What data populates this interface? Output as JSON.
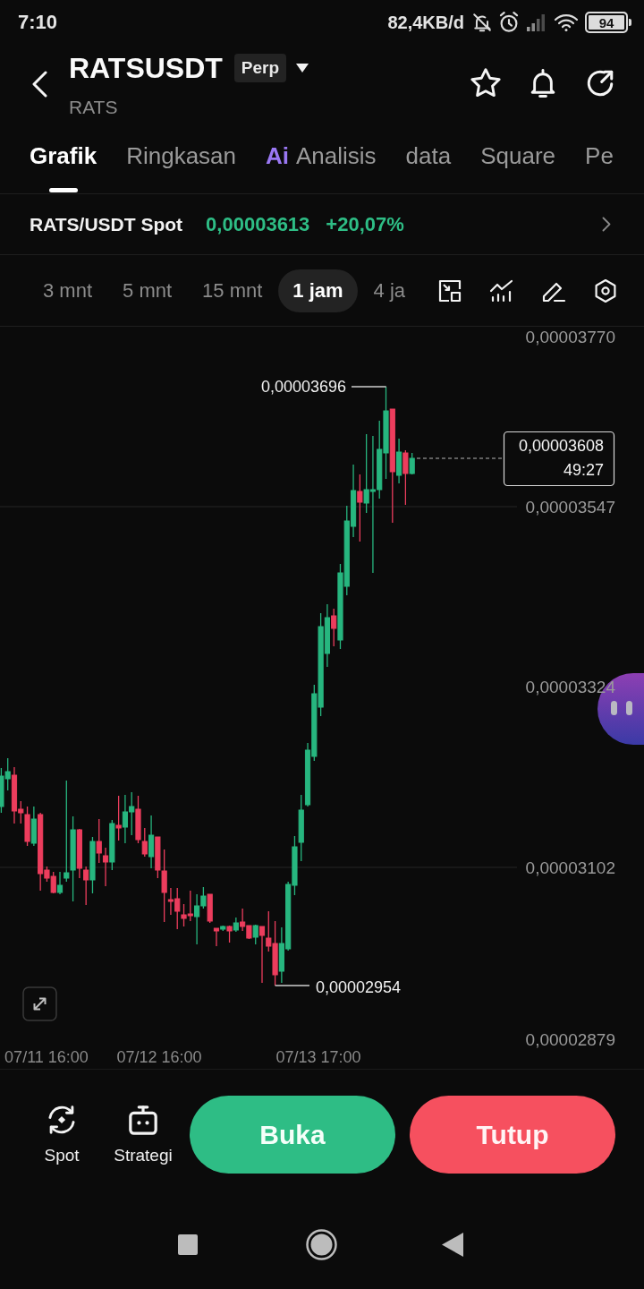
{
  "status_bar": {
    "time": "7:10",
    "network_speed": "82,4KB/d",
    "battery": "94"
  },
  "header": {
    "title": "RATSUSDT",
    "market_badge": "Perp",
    "subtitle": "RATS"
  },
  "tabs": [
    {
      "label": "Grafik",
      "selected": true
    },
    {
      "label": "Ringkasan",
      "selected": false
    },
    {
      "label": "Analisis",
      "badge": "Ai",
      "selected": false
    },
    {
      "label": "data",
      "selected": false
    },
    {
      "label": "Square",
      "selected": false
    },
    {
      "label": "Pe",
      "selected": false
    }
  ],
  "spot_ticker": {
    "pair": "RATS/USDT Spot",
    "price": "0,00003613",
    "change": "+20,07%"
  },
  "intervals": [
    {
      "label": "3 mnt",
      "selected": false
    },
    {
      "label": "5 mnt",
      "selected": false
    },
    {
      "label": "15 mnt",
      "selected": false
    },
    {
      "label": "1 jam",
      "selected": true
    },
    {
      "label": "4 ja",
      "selected": false
    }
  ],
  "chart": {
    "price_axis": [
      "0,00003770",
      "0,00003547",
      "0,00003324",
      "0,00003102",
      "0,00002879"
    ],
    "time_axis": [
      "07/11 16:00",
      "07/12 16:00",
      "07/13 17:00"
    ],
    "high_label": "0,00003696",
    "low_label": "0,00002954",
    "current_price": "0,00003608",
    "countdown": "49:27"
  },
  "bottom_bar": {
    "shortcuts": [
      {
        "label": "Spot",
        "kind": "spot"
      },
      {
        "label": "Strategi",
        "kind": "strategy"
      }
    ],
    "actions": [
      {
        "label": "Buka",
        "kind": "open"
      },
      {
        "label": "Tutup",
        "kind": "close"
      }
    ]
  }
}
